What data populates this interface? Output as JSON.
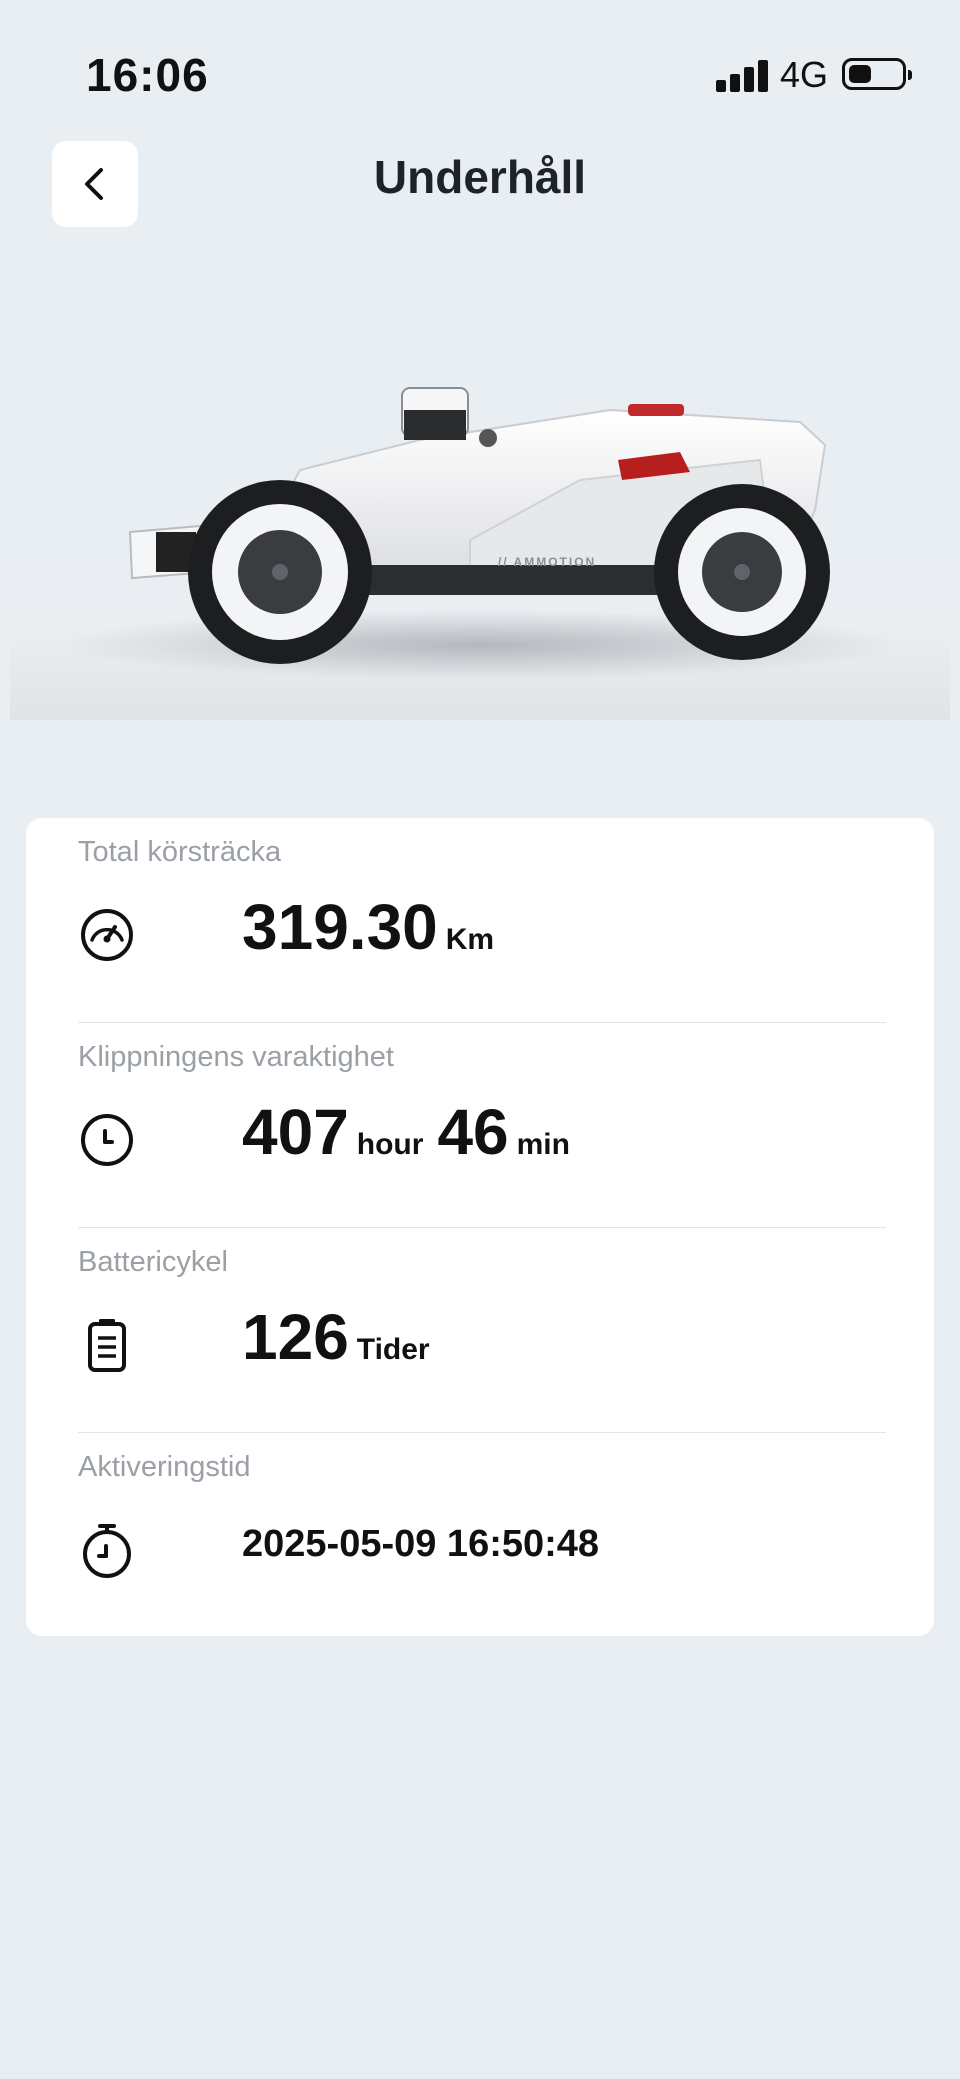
{
  "status_bar": {
    "time": "16:06",
    "network": "4G",
    "battery_level": 0.35
  },
  "header": {
    "title": "Underhåll",
    "back_icon": "chevron-left-icon"
  },
  "product": {
    "brand": "AMMOTION"
  },
  "stats": [
    {
      "label": "Total körsträcka",
      "icon": "speedometer-icon",
      "value": "319.30",
      "unit": "Km"
    },
    {
      "label": "Klippningens varaktighet",
      "icon": "clock-icon",
      "hours": "407",
      "hours_unit": "hour",
      "minutes": "46",
      "minutes_unit": "min"
    },
    {
      "label": "Battericykel",
      "icon": "battery-icon",
      "value": "126",
      "unit": "Tider"
    },
    {
      "label": "Aktiveringstid",
      "icon": "stopwatch-icon",
      "value": "2025-05-09 16:50:48"
    }
  ]
}
